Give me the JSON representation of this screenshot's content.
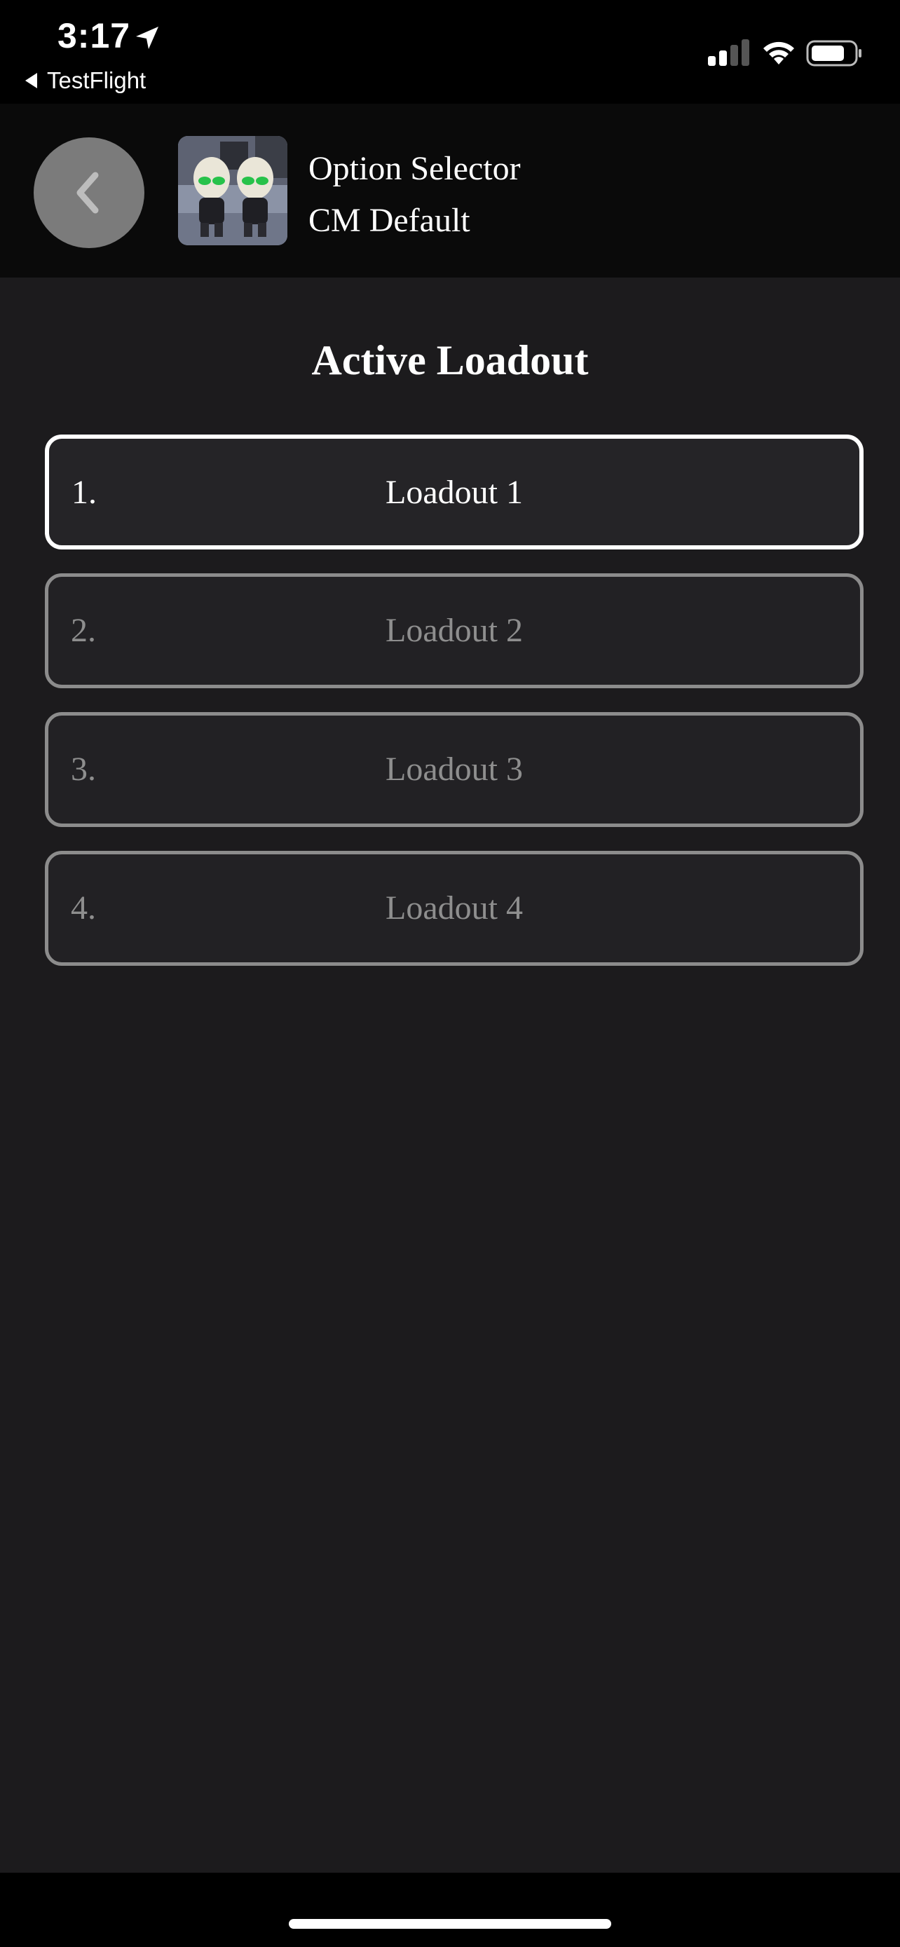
{
  "status_bar": {
    "time": "3:17",
    "back_app_label": "TestFlight",
    "icons": [
      "location-arrow-icon",
      "cellular-signal-icon",
      "wifi-icon",
      "battery-icon"
    ]
  },
  "header": {
    "title": "Option Selector",
    "subtitle": "CM Default",
    "back_icon": "chevron-left-icon"
  },
  "main": {
    "title": "Active Loadout",
    "loadouts": [
      {
        "number": "1.",
        "label": "Loadout 1",
        "active": true
      },
      {
        "number": "2.",
        "label": "Loadout 2",
        "active": false
      },
      {
        "number": "3.",
        "label": "Loadout 3",
        "active": false
      },
      {
        "number": "4.",
        "label": "Loadout 4",
        "active": false
      }
    ]
  },
  "colors": {
    "background": "#1c1b1d",
    "header_background": "#0a0a0a",
    "active_border": "#ffffff",
    "inactive_border": "#8c8c8c",
    "inactive_text": "#8e8e8e",
    "back_button": "#7b7b7b"
  }
}
